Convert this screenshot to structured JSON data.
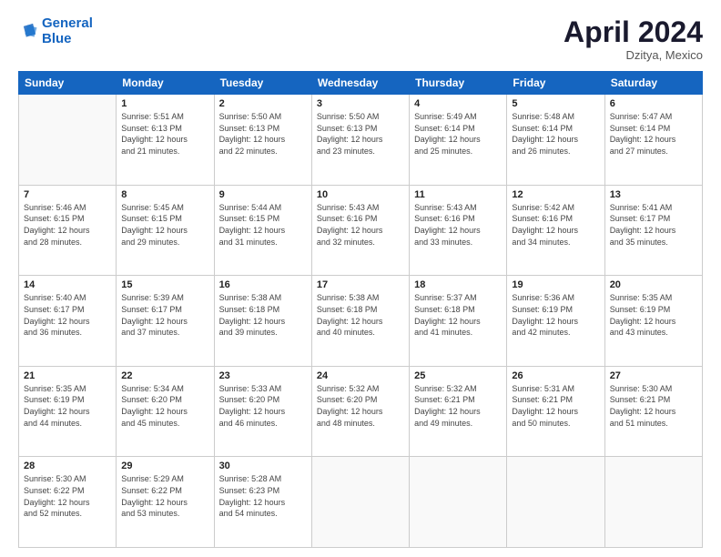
{
  "header": {
    "logo_line1": "General",
    "logo_line2": "Blue",
    "month": "April 2024",
    "location": "Dzitya, Mexico"
  },
  "weekdays": [
    "Sunday",
    "Monday",
    "Tuesday",
    "Wednesday",
    "Thursday",
    "Friday",
    "Saturday"
  ],
  "weeks": [
    [
      {
        "day": "",
        "info": ""
      },
      {
        "day": "1",
        "info": "Sunrise: 5:51 AM\nSunset: 6:13 PM\nDaylight: 12 hours\nand 21 minutes."
      },
      {
        "day": "2",
        "info": "Sunrise: 5:50 AM\nSunset: 6:13 PM\nDaylight: 12 hours\nand 22 minutes."
      },
      {
        "day": "3",
        "info": "Sunrise: 5:50 AM\nSunset: 6:13 PM\nDaylight: 12 hours\nand 23 minutes."
      },
      {
        "day": "4",
        "info": "Sunrise: 5:49 AM\nSunset: 6:14 PM\nDaylight: 12 hours\nand 25 minutes."
      },
      {
        "day": "5",
        "info": "Sunrise: 5:48 AM\nSunset: 6:14 PM\nDaylight: 12 hours\nand 26 minutes."
      },
      {
        "day": "6",
        "info": "Sunrise: 5:47 AM\nSunset: 6:14 PM\nDaylight: 12 hours\nand 27 minutes."
      }
    ],
    [
      {
        "day": "7",
        "info": "Sunrise: 5:46 AM\nSunset: 6:15 PM\nDaylight: 12 hours\nand 28 minutes."
      },
      {
        "day": "8",
        "info": "Sunrise: 5:45 AM\nSunset: 6:15 PM\nDaylight: 12 hours\nand 29 minutes."
      },
      {
        "day": "9",
        "info": "Sunrise: 5:44 AM\nSunset: 6:15 PM\nDaylight: 12 hours\nand 31 minutes."
      },
      {
        "day": "10",
        "info": "Sunrise: 5:43 AM\nSunset: 6:16 PM\nDaylight: 12 hours\nand 32 minutes."
      },
      {
        "day": "11",
        "info": "Sunrise: 5:43 AM\nSunset: 6:16 PM\nDaylight: 12 hours\nand 33 minutes."
      },
      {
        "day": "12",
        "info": "Sunrise: 5:42 AM\nSunset: 6:16 PM\nDaylight: 12 hours\nand 34 minutes."
      },
      {
        "day": "13",
        "info": "Sunrise: 5:41 AM\nSunset: 6:17 PM\nDaylight: 12 hours\nand 35 minutes."
      }
    ],
    [
      {
        "day": "14",
        "info": "Sunrise: 5:40 AM\nSunset: 6:17 PM\nDaylight: 12 hours\nand 36 minutes."
      },
      {
        "day": "15",
        "info": "Sunrise: 5:39 AM\nSunset: 6:17 PM\nDaylight: 12 hours\nand 37 minutes."
      },
      {
        "day": "16",
        "info": "Sunrise: 5:38 AM\nSunset: 6:18 PM\nDaylight: 12 hours\nand 39 minutes."
      },
      {
        "day": "17",
        "info": "Sunrise: 5:38 AM\nSunset: 6:18 PM\nDaylight: 12 hours\nand 40 minutes."
      },
      {
        "day": "18",
        "info": "Sunrise: 5:37 AM\nSunset: 6:18 PM\nDaylight: 12 hours\nand 41 minutes."
      },
      {
        "day": "19",
        "info": "Sunrise: 5:36 AM\nSunset: 6:19 PM\nDaylight: 12 hours\nand 42 minutes."
      },
      {
        "day": "20",
        "info": "Sunrise: 5:35 AM\nSunset: 6:19 PM\nDaylight: 12 hours\nand 43 minutes."
      }
    ],
    [
      {
        "day": "21",
        "info": "Sunrise: 5:35 AM\nSunset: 6:19 PM\nDaylight: 12 hours\nand 44 minutes."
      },
      {
        "day": "22",
        "info": "Sunrise: 5:34 AM\nSunset: 6:20 PM\nDaylight: 12 hours\nand 45 minutes."
      },
      {
        "day": "23",
        "info": "Sunrise: 5:33 AM\nSunset: 6:20 PM\nDaylight: 12 hours\nand 46 minutes."
      },
      {
        "day": "24",
        "info": "Sunrise: 5:32 AM\nSunset: 6:20 PM\nDaylight: 12 hours\nand 48 minutes."
      },
      {
        "day": "25",
        "info": "Sunrise: 5:32 AM\nSunset: 6:21 PM\nDaylight: 12 hours\nand 49 minutes."
      },
      {
        "day": "26",
        "info": "Sunrise: 5:31 AM\nSunset: 6:21 PM\nDaylight: 12 hours\nand 50 minutes."
      },
      {
        "day": "27",
        "info": "Sunrise: 5:30 AM\nSunset: 6:21 PM\nDaylight: 12 hours\nand 51 minutes."
      }
    ],
    [
      {
        "day": "28",
        "info": "Sunrise: 5:30 AM\nSunset: 6:22 PM\nDaylight: 12 hours\nand 52 minutes."
      },
      {
        "day": "29",
        "info": "Sunrise: 5:29 AM\nSunset: 6:22 PM\nDaylight: 12 hours\nand 53 minutes."
      },
      {
        "day": "30",
        "info": "Sunrise: 5:28 AM\nSunset: 6:23 PM\nDaylight: 12 hours\nand 54 minutes."
      },
      {
        "day": "",
        "info": ""
      },
      {
        "day": "",
        "info": ""
      },
      {
        "day": "",
        "info": ""
      },
      {
        "day": "",
        "info": ""
      }
    ]
  ]
}
